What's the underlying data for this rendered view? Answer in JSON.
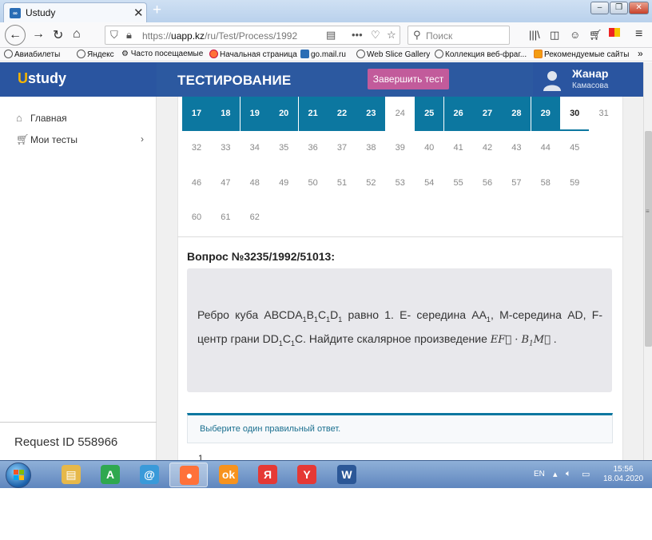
{
  "browser": {
    "tab_title": "Ustudy",
    "url_scheme": "https://",
    "url_host": "uapp.kz",
    "url_path": "/ru/Test/Process/1992",
    "search_placeholder": "Поиск",
    "bookmarks": [
      "Авиабилеты",
      "Яндекс",
      "Часто посещаемые",
      "Начальная страница",
      "go.mail.ru",
      "Web Slice Gallery",
      "Коллекция веб-фраг...",
      "Рекомендуемые сайты"
    ]
  },
  "header": {
    "logo_u": "U",
    "logo_rest": "study",
    "title": "ТЕСТИРОВАНИЕ",
    "finish_button": "Завершить тест",
    "user_name": "Жанар",
    "user_surname": "Камасова"
  },
  "sidebar": {
    "items": [
      {
        "label": "Главная",
        "icon": "home-icon"
      },
      {
        "label": "Мои тесты",
        "icon": "cart-icon"
      }
    ],
    "request_id": "Request ID 558966"
  },
  "question_grid": {
    "rows": [
      [
        {
          "n": "17",
          "state": "done"
        },
        {
          "n": "18",
          "state": "done"
        },
        {
          "n": "19",
          "state": "done"
        },
        {
          "n": "20",
          "state": "done"
        },
        {
          "n": "21",
          "state": "done"
        },
        {
          "n": "22",
          "state": "done"
        },
        {
          "n": "23",
          "state": "done"
        },
        {
          "n": "24",
          "state": "open"
        },
        {
          "n": "25",
          "state": "done"
        },
        {
          "n": "26",
          "state": "done"
        },
        {
          "n": "27",
          "state": "done"
        },
        {
          "n": "28",
          "state": "done"
        },
        {
          "n": "29",
          "state": "done"
        },
        {
          "n": "30",
          "state": "current"
        },
        {
          "n": "31",
          "state": "open"
        }
      ],
      [
        {
          "n": "32",
          "state": "open"
        },
        {
          "n": "33",
          "state": "open"
        },
        {
          "n": "34",
          "state": "open"
        },
        {
          "n": "35",
          "state": "open"
        },
        {
          "n": "36",
          "state": "open"
        },
        {
          "n": "37",
          "state": "open"
        },
        {
          "n": "38",
          "state": "open"
        },
        {
          "n": "39",
          "state": "open"
        },
        {
          "n": "40",
          "state": "open"
        },
        {
          "n": "41",
          "state": "open"
        },
        {
          "n": "42",
          "state": "open"
        },
        {
          "n": "43",
          "state": "open"
        },
        {
          "n": "44",
          "state": "open"
        },
        {
          "n": "45",
          "state": "open"
        }
      ],
      [
        {
          "n": "46",
          "state": "open"
        },
        {
          "n": "47",
          "state": "open"
        },
        {
          "n": "48",
          "state": "open"
        },
        {
          "n": "49",
          "state": "open"
        },
        {
          "n": "50",
          "state": "open"
        },
        {
          "n": "51",
          "state": "open"
        },
        {
          "n": "52",
          "state": "open"
        },
        {
          "n": "53",
          "state": "open"
        },
        {
          "n": "54",
          "state": "open"
        },
        {
          "n": "55",
          "state": "open"
        },
        {
          "n": "56",
          "state": "open"
        },
        {
          "n": "57",
          "state": "open"
        },
        {
          "n": "58",
          "state": "open"
        },
        {
          "n": "59",
          "state": "open"
        }
      ],
      [
        {
          "n": "60",
          "state": "open"
        },
        {
          "n": "61",
          "state": "open"
        },
        {
          "n": "62",
          "state": "open"
        }
      ]
    ]
  },
  "question": {
    "title": "Вопрос №3235/1992/51013:",
    "text_html": "Ребро куба ABCDA<sub>1</sub>B<sub>1</sub>C<sub>1</sub>D<sub>1</sub> равно 1. E- середина AA<sub>1</sub>, M-середина AD, F-центр грани DD<sub>1</sub>C<sub>1</sub>C. Найдите скалярное произведение <span class=\"formula\">EF&#8407; · B<sub>1</sub>M&#8407;</span> .",
    "answer_prompt": "Выберите один правильный ответ.",
    "next_option_peek": "1"
  },
  "taskbar": {
    "apps": [
      {
        "icon": "explorer-icon",
        "glyph": "▤",
        "color": "#e6b84a"
      },
      {
        "icon": "a-app-icon",
        "glyph": "A",
        "color": "#2fa84f"
      },
      {
        "icon": "mail-icon",
        "glyph": "@",
        "color": "#3a9ad9"
      },
      {
        "icon": "firefox-icon",
        "glyph": "●",
        "color": "#ff7139"
      },
      {
        "icon": "odnoklassniki-icon",
        "glyph": "ok",
        "color": "#f7931e"
      },
      {
        "icon": "yandex-icon",
        "glyph": "Я",
        "color": "#e53935"
      },
      {
        "icon": "yandex-browser-icon",
        "glyph": "Y",
        "color": "#e53935"
      },
      {
        "icon": "word-icon",
        "glyph": "W",
        "color": "#2b5797"
      }
    ],
    "lang": "EN",
    "time": "15:56",
    "date": "18.04.2020"
  }
}
